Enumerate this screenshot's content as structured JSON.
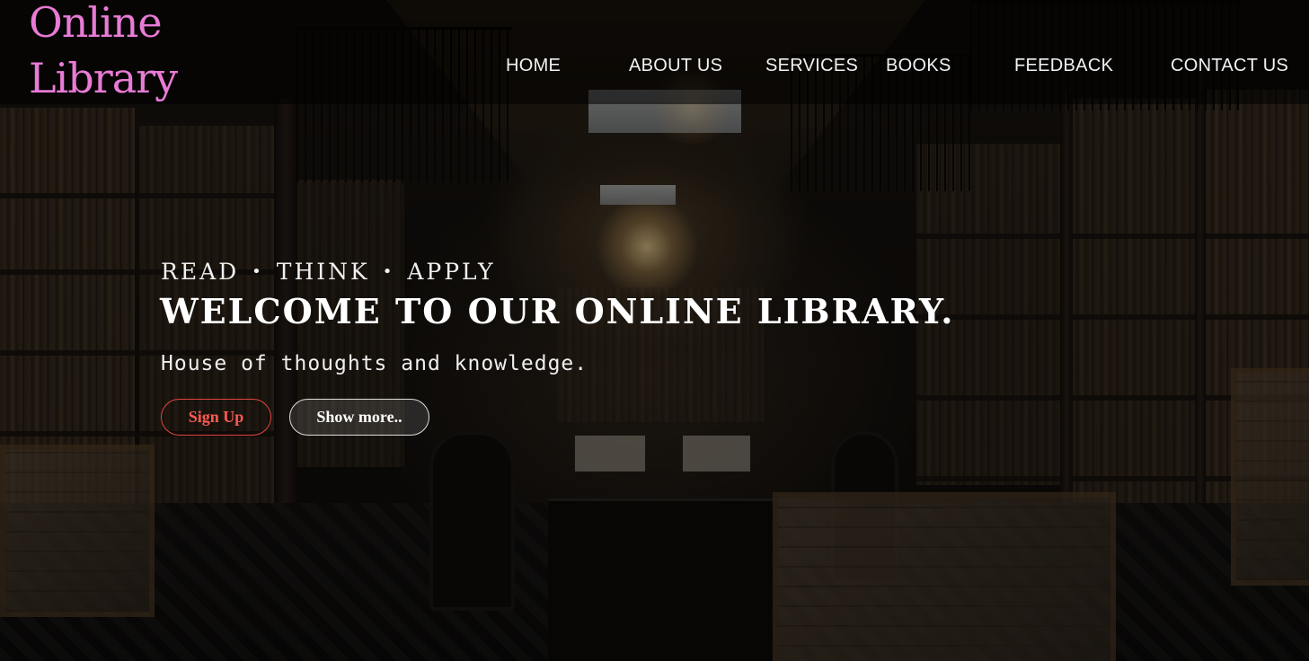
{
  "brand": {
    "logo_line1": "Online",
    "logo_line2": "Library",
    "logo_color": "#e87bd6"
  },
  "nav": {
    "items": [
      {
        "label": "HOME"
      },
      {
        "label": "ABOUT US"
      },
      {
        "label": "SERVICES"
      },
      {
        "label": "BOOKS"
      },
      {
        "label": "FEEDBACK"
      },
      {
        "label": "CONTACT US"
      }
    ]
  },
  "hero": {
    "tagline_words": [
      "READ",
      "THINK",
      "APPLY"
    ],
    "tagline_separator": "•",
    "headline": "WELCOME TO OUR ONLINE LIBRARY.",
    "subline": "House of thoughts and knowledge.",
    "signup_label": "Sign Up",
    "show_more_label": "Show more..",
    "accent_color": "#e2463d",
    "background_icon": "library-hall-photo"
  }
}
